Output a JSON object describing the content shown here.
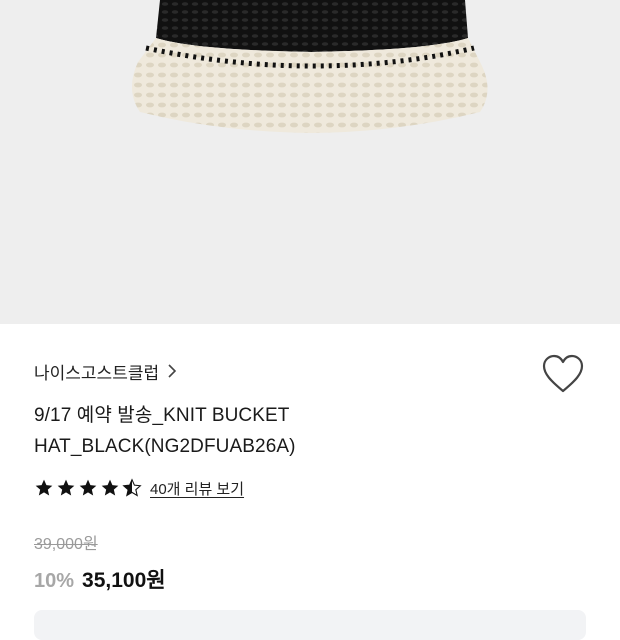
{
  "product": {
    "image_alt": "knit bucket hat",
    "brand": "나이스고스트클럽",
    "brand_chevron_icon": "chevron-right-icon",
    "wishlist_icon": "heart-outline-icon",
    "title_line1": "9/17 예약 발송_KNIT BUCKET",
    "title_line2": "HAT_BLACK(NG2DFUAB26A)",
    "rating": 4.5,
    "rating_max": 5,
    "review_link": "40개 리뷰 보기",
    "original_price": "39,000원",
    "discount": "10%",
    "sale_price": "35,100원"
  },
  "colors": {
    "hat_black": "#111111",
    "hat_cream": "#efe9dc",
    "background": "#eeeeee",
    "star": "#111111",
    "discount": "#a7a7a7",
    "muted": "#9a9a9a"
  }
}
